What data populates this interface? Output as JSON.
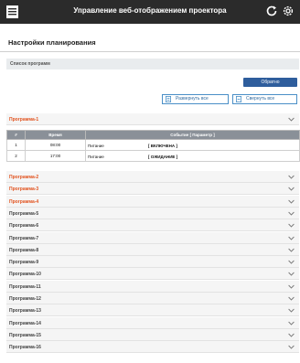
{
  "app": {
    "title": "Управление веб-отображением проектора"
  },
  "page": {
    "title": "Настройки планирования"
  },
  "section": {
    "label": "Список программ"
  },
  "buttons": {
    "back": "Обратно",
    "expand_all": "Развернуть все",
    "collapse_all": "Свернуть все"
  },
  "table": {
    "headers": [
      "#",
      "Время",
      "Событие [ Параметр ]"
    ],
    "rows": [
      {
        "num": "1",
        "time": "08:00",
        "event": "Питание",
        "param": "[ ВКЛЮЧЕНА ]"
      },
      {
        "num": "2",
        "time": "17:00",
        "event": "Питание",
        "param": "[ ОЖИДАНИЕ ]"
      }
    ]
  },
  "programs": [
    {
      "label": "Программа-1",
      "highlighted": true,
      "expanded": true
    },
    {
      "label": "Программа-2",
      "highlighted": true
    },
    {
      "label": "Программа-3",
      "highlighted": true
    },
    {
      "label": "Программа-4",
      "highlighted": true
    },
    {
      "label": "Программа-5"
    },
    {
      "label": "Программа-6"
    },
    {
      "label": "Программа-7"
    },
    {
      "label": "Программа-8"
    },
    {
      "label": "Программа-9"
    },
    {
      "label": "Программа-10"
    },
    {
      "label": "Программа-11"
    },
    {
      "label": "Программа-12"
    },
    {
      "label": "Программа-13"
    },
    {
      "label": "Программа-14"
    },
    {
      "label": "Программа-15"
    },
    {
      "label": "Программа-16"
    }
  ],
  "colors": {
    "highlight": "#e2531f",
    "accent": "#2e5d9c",
    "header_bg": "#2b2b2b"
  },
  "icons": {
    "logo": "document-icon",
    "refresh": "refresh-icon",
    "settings": "gear-icon",
    "expand": "expand-icon",
    "collapse": "collapse-icon",
    "chevron": "chevron-down-icon"
  }
}
